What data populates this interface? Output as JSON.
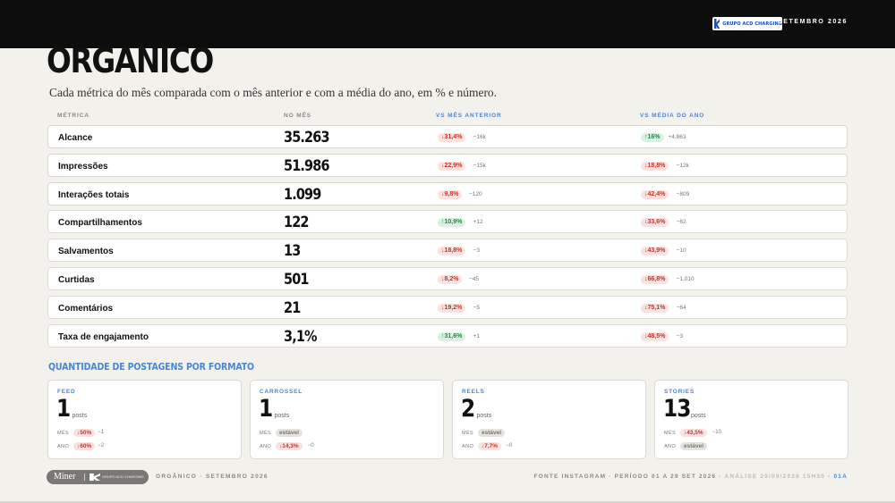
{
  "header": {
    "brand_text": "GRUPO ACD CHARGING",
    "month": "SETEMBRO 2026"
  },
  "page": {
    "title": "ORGANICO",
    "subtitle": "Cada métrica do mês comparada com o mês anterior e com a média do ano, em % e número."
  },
  "table": {
    "columns": [
      "MÉTRICA",
      "NO MÊS",
      "VS MÊS ANTERIOR",
      "VS MÉDIA DO ANO"
    ],
    "rows": [
      {
        "label": "Alcance",
        "value": "35.263",
        "mom_pct": "↓31,4%",
        "mom_trend": "neg",
        "mom_abs": "−16k",
        "yoy_pct": "↑16%",
        "yoy_trend": "pos",
        "yoy_abs": "+4.863"
      },
      {
        "label": "Impressões",
        "value": "51.986",
        "mom_pct": "↓22,9%",
        "mom_trend": "neg",
        "mom_abs": "−15k",
        "yoy_pct": "↓18,8%",
        "yoy_trend": "neg",
        "yoy_abs": "−12k"
      },
      {
        "label": "Interações totais",
        "value": "1.099",
        "mom_pct": "↓9,8%",
        "mom_trend": "neg",
        "mom_abs": "−120",
        "yoy_pct": "↓42,4%",
        "yoy_trend": "neg",
        "yoy_abs": "−809"
      },
      {
        "label": "Compartilhamentos",
        "value": "122",
        "mom_pct": "↑10,9%",
        "mom_trend": "pos",
        "mom_abs": "+12",
        "yoy_pct": "↓33,6%",
        "yoy_trend": "neg",
        "yoy_abs": "−62"
      },
      {
        "label": "Salvamentos",
        "value": "13",
        "mom_pct": "↓18,8%",
        "mom_trend": "neg",
        "mom_abs": "−3",
        "yoy_pct": "↓43,9%",
        "yoy_trend": "neg",
        "yoy_abs": "−10"
      },
      {
        "label": "Curtidas",
        "value": "501",
        "mom_pct": "↓8,2%",
        "mom_trend": "neg",
        "mom_abs": "−45",
        "yoy_pct": "↓66,8%",
        "yoy_trend": "neg",
        "yoy_abs": "−1.010"
      },
      {
        "label": "Comentários",
        "value": "21",
        "mom_pct": "↓19,2%",
        "mom_trend": "neg",
        "mom_abs": "−5",
        "yoy_pct": "↓75,1%",
        "yoy_trend": "neg",
        "yoy_abs": "−64"
      },
      {
        "label": "Taxa de engajamento",
        "value": "3,1%",
        "mom_pct": "↑31,6%",
        "mom_trend": "pos",
        "mom_abs": "+1",
        "yoy_pct": "↓48,5%",
        "yoy_trend": "neg",
        "yoy_abs": "−3"
      }
    ]
  },
  "formats": {
    "title": "QUANTIDADE DE POSTAGENS POR FORMATO",
    "mes_label": "MÊS",
    "ano_label": "ANO",
    "unit": "posts",
    "cards": [
      {
        "name": "FEED",
        "count": "1",
        "mes_pct": "↓50%",
        "mes_trend": "neg",
        "mes_abs": "−1",
        "ano_pct": "↓60%",
        "ano_trend": "neg",
        "ano_abs": "−2"
      },
      {
        "name": "CARROSSEL",
        "count": "1",
        "mes_pct": "estável",
        "mes_trend": "neu",
        "mes_abs": "",
        "ano_pct": "↓14,3%",
        "ano_trend": "neg",
        "ano_abs": "−0"
      },
      {
        "name": "REELS",
        "count": "2",
        "mes_pct": "estável",
        "mes_trend": "neu",
        "mes_abs": "",
        "ano_pct": "↓7,7%",
        "ano_trend": "neg",
        "ano_abs": "−0"
      },
      {
        "name": "STORIES",
        "count": "13",
        "mes_pct": "↓43,5%",
        "mes_trend": "neg",
        "mes_abs": "−10",
        "ano_pct": "estável",
        "ano_trend": "neu",
        "ano_abs": ""
      }
    ]
  },
  "footer": {
    "miner": "Miner",
    "partner_text": "GRUPO ACD CHARGING",
    "left": "ORGÂNICO · SETEMBRO 2026",
    "source": "FONTE INSTAGRAM",
    "period": "PERÍODO 01 A 29 SET 2026",
    "analysis": "ANÁLISE 29/09/2026 15H30",
    "page_code": "01A",
    "sep": "·"
  }
}
